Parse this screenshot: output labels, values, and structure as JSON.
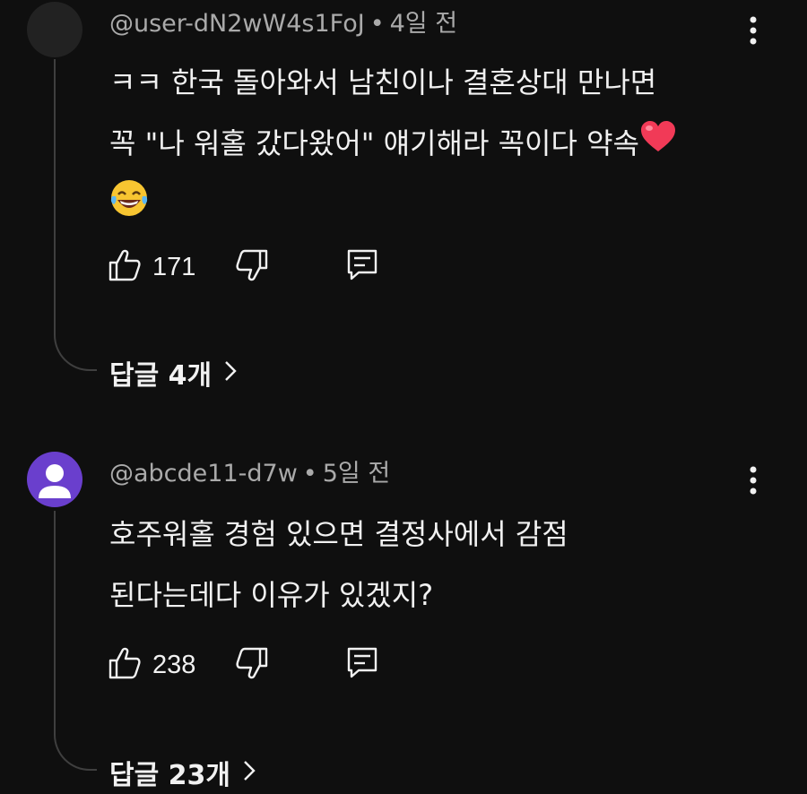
{
  "comments": [
    {
      "author": "@user-dN2wW4s1FoJ",
      "separator": "•",
      "time": "4일 전",
      "lines": [
        "ㅋㅋ 한국 돌아와서 남친이나 결혼상대 만나면",
        "꼭 \"나 워홀 갔다왔어\" 얘기해라 꼭이다 약속"
      ],
      "emojis": [
        "heart-emoji",
        "tears-of-joy-emoji"
      ],
      "likes": "171",
      "replies_label": "답글 4개"
    },
    {
      "author": "@abcde11-d7w",
      "separator": "•",
      "time": "5일 전",
      "lines": [
        "호주워홀 경험 있으면 결정사에서 감점",
        "된다는데다 이유가 있겠지?"
      ],
      "likes": "238",
      "replies_label": "답글 23개"
    }
  ],
  "icons": {
    "like": "thumbs-up-icon",
    "dislike": "thumbs-down-icon",
    "reply": "reply-comment-icon",
    "more": "more-vertical-icon",
    "chevron": "chevron-right-icon"
  },
  "colors": {
    "background": "#0f0f0f",
    "text": "#f1f1f1",
    "meta": "#aaaaaa",
    "avatar_purple": "#6a3fcd",
    "thread_line": "#3f3f3f"
  }
}
